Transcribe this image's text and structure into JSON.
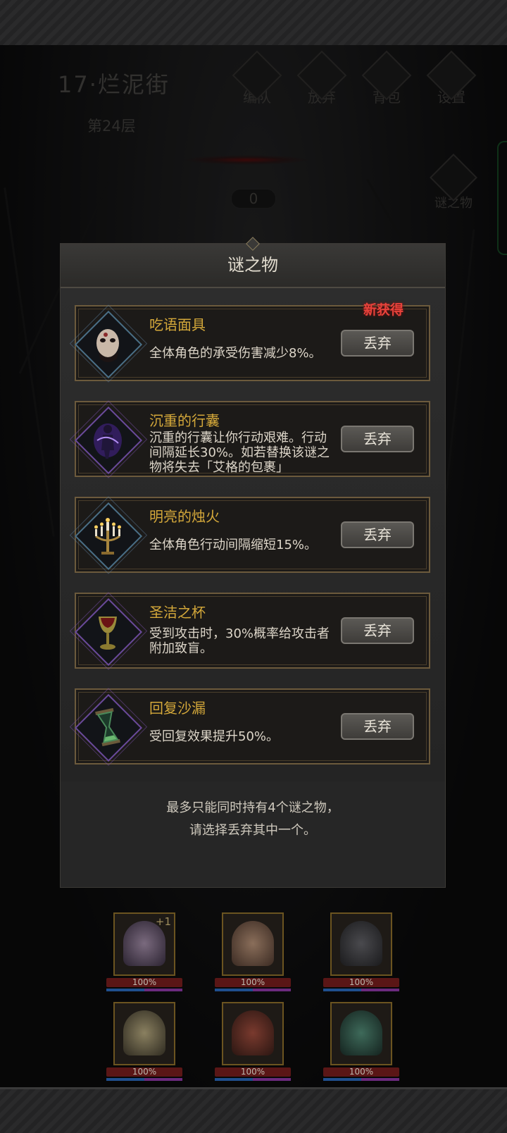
{
  "location": {
    "title": "17·烂泥街",
    "floor": "第24层"
  },
  "nav": [
    "编队",
    "放弃",
    "背包",
    "设置"
  ],
  "side_button": "谜之物",
  "counter": "0",
  "modal": {
    "title": "谜之物",
    "new_tag": "新获得",
    "drop_label": "丢弃",
    "items": [
      {
        "name": "吃语面具",
        "desc": "全体角色的承受伤害减少8%。",
        "frame": "blue",
        "icon": "mask-icon"
      },
      {
        "name": "沉重的行囊",
        "desc": "沉重的行囊让你行动艰难。行动间隔延长30%。如若替换该谜之物将失去「艾格的包裹」",
        "frame": "purple",
        "icon": "heavy-pack-icon"
      },
      {
        "name": "明亮的烛火",
        "desc": "全体角色行动间隔缩短15%。",
        "frame": "blue",
        "icon": "candelabra-icon"
      },
      {
        "name": "圣洁之杯",
        "desc": "受到攻击时，30%概率给攻击者附加致盲。",
        "frame": "purple",
        "icon": "chalice-icon"
      },
      {
        "name": "回复沙漏",
        "desc": "受回复效果提升50%。",
        "frame": "purple",
        "icon": "hourglass-icon"
      }
    ],
    "footnote_line1": "最多只能同时持有4个谜之物，",
    "footnote_line2": "请选择丢弃其中一个。"
  },
  "party": [
    {
      "hp": "100%",
      "badge": "+1"
    },
    {
      "hp": "100%"
    },
    {
      "hp": "100%"
    },
    {
      "hp": "100%"
    },
    {
      "hp": "100%"
    },
    {
      "hp": "100%"
    }
  ],
  "colors": {
    "gold": "#d4a83a",
    "new_red": "#e8423b",
    "hp_red": "#5a1616"
  }
}
